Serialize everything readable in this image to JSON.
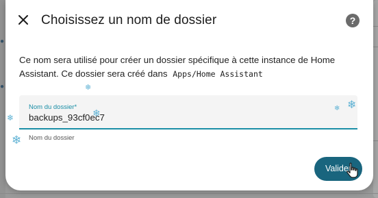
{
  "dialog": {
    "title": "Choisissez un nom de dossier",
    "description_main": "Ce nom sera utilisé pour créer un dossier spécifique à cette instance de Home Assistant. Ce dossier sera créé dans",
    "description_path": "Apps/Home Assistant",
    "field": {
      "label": "Nom du dossier*",
      "value": "backups_93cf0ec7",
      "helper": "Nom du dossier"
    },
    "submit_label": "Valider"
  },
  "icons": {
    "close": "close-icon",
    "help": "help-circle-icon",
    "cursor": "hand-pointer-icon",
    "decoration": "snowflake-icon"
  },
  "colors": {
    "accent": "#1a8ea6",
    "button": "#19657e",
    "snowflake": "#5fb2d4"
  }
}
